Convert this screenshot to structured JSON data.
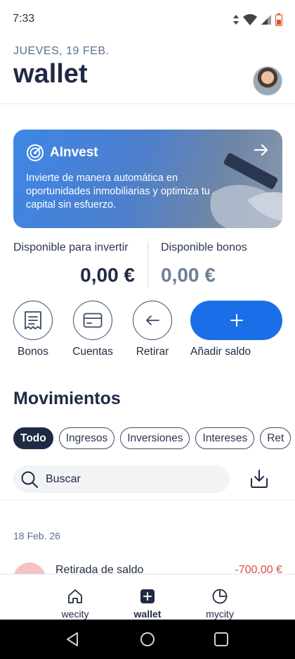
{
  "status_bar": {
    "time": "7:33"
  },
  "header": {
    "date": "JUEVES, 19 FEB.",
    "title": "wallet"
  },
  "banner": {
    "title": "AInvest",
    "text": "Invierte de manera automática en oportunidades inmobiliarias y optimiza tu capital sin esfuerzo."
  },
  "balances": {
    "available_label": "Disponible para invertir",
    "available_value": "0,00 €",
    "bonus_label": "Disponible bonos",
    "bonus_value": "0,00 €"
  },
  "actions": {
    "bonos": "Bonos",
    "cuentas": "Cuentas",
    "retirar": "Retirar",
    "add": "Añadir saldo"
  },
  "movements": {
    "title": "Movimientos",
    "filters": [
      "Todo",
      "Ingresos",
      "Inversiones",
      "Intereses",
      "Ret"
    ],
    "search_placeholder": "Buscar",
    "date": "18 Feb. 26",
    "transaction": {
      "description": "Retirada de saldo",
      "amount": "-700,00 €"
    }
  },
  "nav": {
    "wecity": "wecity",
    "wallet": "wallet",
    "mycity": "mycity"
  },
  "colors": {
    "accent": "#1a6fe8",
    "text": "#1f2a44",
    "negative": "#e24b4b"
  }
}
